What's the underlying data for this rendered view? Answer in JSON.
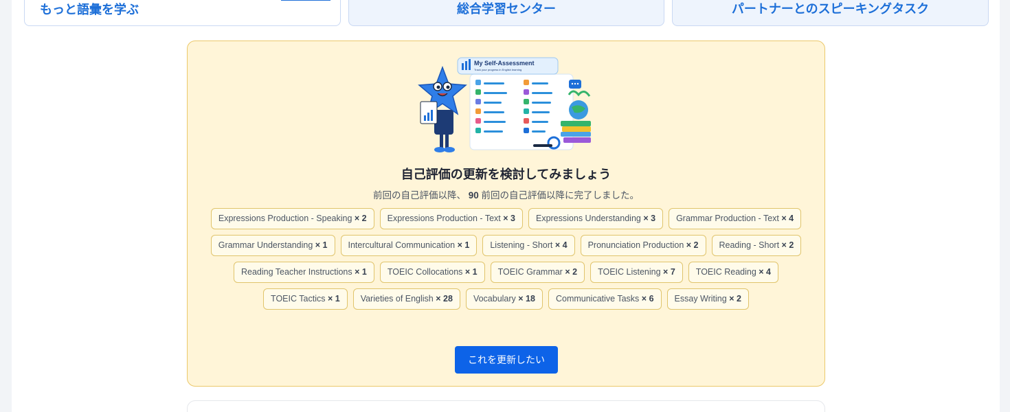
{
  "top_cards": {
    "vocab_title": "もっと語彙を学ぶ",
    "center_title": "総合学習センター",
    "partner_title": "パートナーとのスピーキングタスク"
  },
  "assessment": {
    "illustration": {
      "heading": "My Self-Assessment",
      "subheading": "Track your progress in English learning"
    },
    "title": "自己評価の更新を検討してみましょう",
    "subtitle_prefix": "前回の自己評価以降、",
    "subtitle_count": "90",
    "subtitle_suffix": " 前回の自己評価以降に完了しました。",
    "chips": [
      {
        "label": "Expressions Production - Speaking",
        "count": "× 2"
      },
      {
        "label": "Expressions Production - Text",
        "count": "× 3"
      },
      {
        "label": "Expressions Understanding",
        "count": "× 3"
      },
      {
        "label": "Grammar Production - Text",
        "count": "× 4"
      },
      {
        "label": "Grammar Understanding",
        "count": "× 1"
      },
      {
        "label": "Intercultural Communication",
        "count": "× 1"
      },
      {
        "label": "Listening - Short",
        "count": "× 4"
      },
      {
        "label": "Pronunciation Production",
        "count": "× 2"
      },
      {
        "label": "Reading - Short",
        "count": "× 2"
      },
      {
        "label": "Reading Teacher Instructions",
        "count": "× 1"
      },
      {
        "label": "TOEIC Collocations",
        "count": "× 1"
      },
      {
        "label": "TOEIC Grammar",
        "count": "× 2"
      },
      {
        "label": "TOEIC Listening",
        "count": "× 7"
      },
      {
        "label": "TOEIC Reading",
        "count": "× 4"
      },
      {
        "label": "TOEIC Tactics",
        "count": "× 1"
      },
      {
        "label": "Varieties of English",
        "count": "× 28"
      },
      {
        "label": "Vocabulary",
        "count": "× 18"
      },
      {
        "label": "Communicative Tasks",
        "count": "× 6"
      },
      {
        "label": "Essay Writing",
        "count": "× 2"
      }
    ],
    "update_button": "これを更新したい"
  },
  "colors": {
    "accent": "#0d63e8",
    "card_bg": "#fff5d8",
    "card_border": "#ebc86a"
  }
}
